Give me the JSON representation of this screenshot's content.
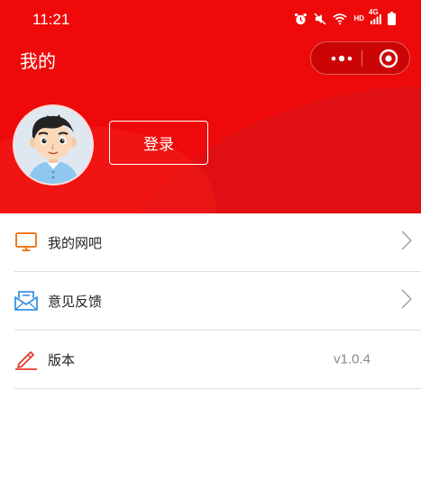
{
  "status_bar": {
    "time": "11:21",
    "network_label": "HD",
    "signal_label": "4G"
  },
  "nav": {
    "title": "我的"
  },
  "profile": {
    "login_label": "登录"
  },
  "menu": {
    "items": [
      {
        "label": "我的网吧",
        "icon": "monitor-icon"
      },
      {
        "label": "意见反馈",
        "icon": "envelope-icon"
      },
      {
        "label": "版本",
        "icon": "pencil-icon",
        "value": "v1.0.4"
      }
    ]
  },
  "colors": {
    "header_red": "#ee0a0a",
    "monitor_orange": "#f07a1c",
    "feedback_blue": "#3a93e6",
    "pencil_red": "#e63b30"
  }
}
